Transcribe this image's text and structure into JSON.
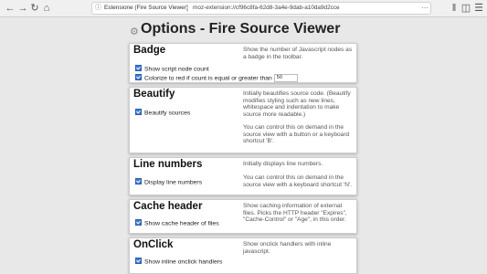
{
  "browser": {
    "url_extension_label": "Estensione (Fire Source Viewer)",
    "url_text": "moz-extension://cf96c8fa-62d8-3a4e-9dab-a10da9d2cce"
  },
  "page": {
    "title": "Options - Fire Source Viewer"
  },
  "sections": [
    {
      "title": "Badge",
      "desc": "Show the number of Javascript nodes as a badge in the toolbar.",
      "options": [
        {
          "label": "Show script node count",
          "checked": true
        },
        {
          "label": "Colorize to red if count is equal or greater than",
          "checked": true,
          "value": "50"
        }
      ]
    },
    {
      "title": "Beautify",
      "desc": "Initially beautifies source code. (Beautify modifies styling such as new lines, whitespace and indentation to make source more readable.)",
      "desc2": "You can control this on demand in the source view with a button or a keyboard shortcut 'B'.",
      "options": [
        {
          "label": "Beautify sources",
          "checked": true
        }
      ]
    },
    {
      "title": "Line numbers",
      "desc": "Initially displays line numbers.",
      "desc2": "You can control this on demand in the source view with a keyboard shortcut 'N'.",
      "options": [
        {
          "label": "Display line numbers",
          "checked": true
        }
      ]
    },
    {
      "title": "Cache header",
      "desc": "Show caching information of external files. Picks the HTTP header \"Expires\", \"Cache-Control\" or \"Age\", in this order.",
      "options": [
        {
          "label": "Show cache header of files",
          "checked": true
        }
      ]
    },
    {
      "title": "OnClick",
      "desc": "Show onclick handlers with inline javascript.",
      "options": [
        {
          "label": "Show inline onclick handlers",
          "checked": true
        }
      ]
    }
  ]
}
